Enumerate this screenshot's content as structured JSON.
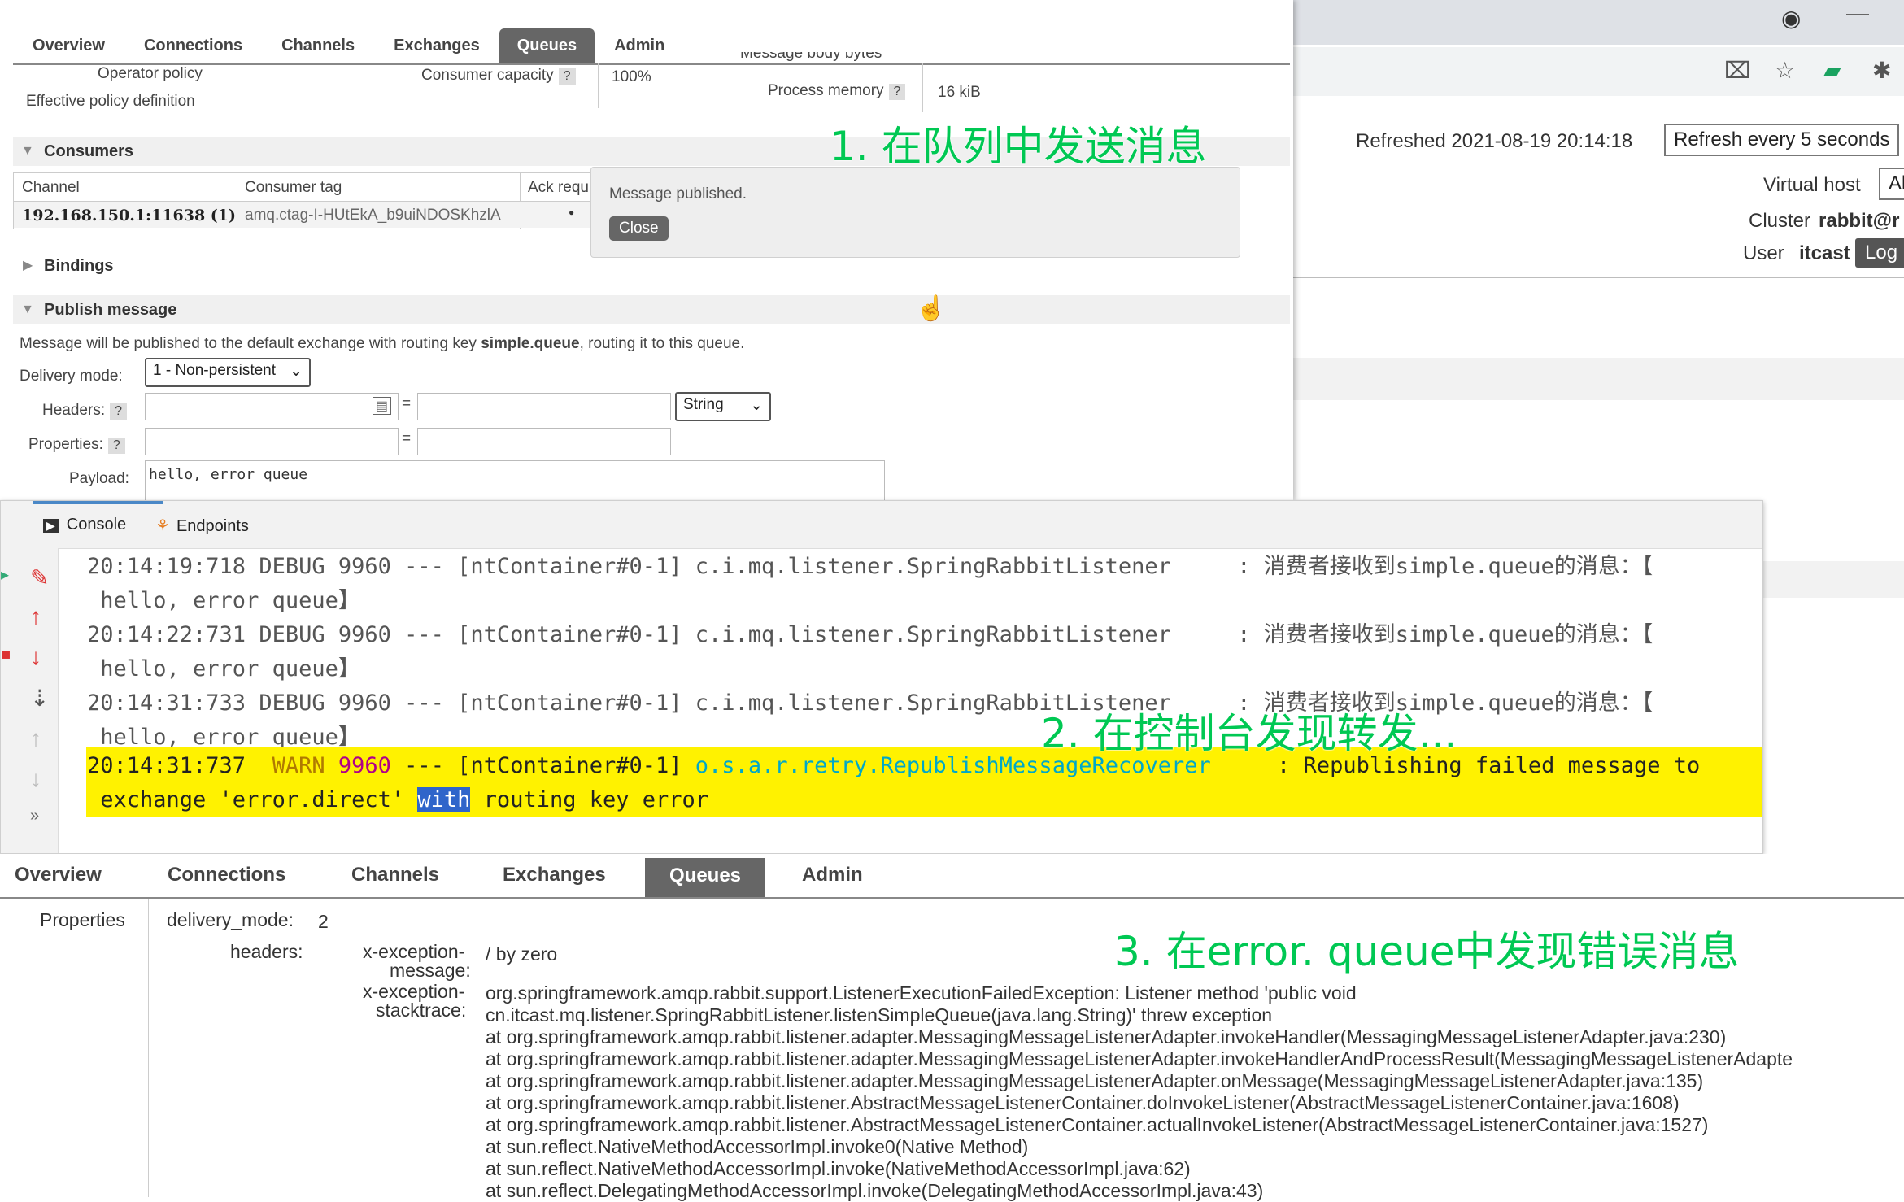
{
  "top_panel": {
    "nav": [
      "Overview",
      "Connections",
      "Channels",
      "Exchanges",
      "Queues",
      "Admin"
    ],
    "active_tab": "Queues",
    "operator_policy_label": "Operator policy",
    "effective_policy_label": "Effective policy definition",
    "consumer_capacity_label": "Consumer capacity",
    "consumer_capacity_value": "100%",
    "message_body_bytes_label": "Message body bytes",
    "process_memory_label": "Process memory",
    "process_memory_value": "16 kiB",
    "consumers_heading": "Consumers",
    "consumers_table": {
      "headers": [
        "Channel",
        "Consumer tag",
        "Ack requ"
      ],
      "row": {
        "channel": "192.168.150.1:11638 (1)",
        "tag": "amq.ctag-I-HUtEkA_b9uiNDOSKhzlA",
        "ack": "●"
      }
    },
    "bindings_heading": "Bindings",
    "publish_heading": "Publish message",
    "publish_info_pre": "Message will be published to the default exchange with routing key ",
    "publish_info_key": "simple.queue",
    "publish_info_post": ", routing it to this queue.",
    "delivery_mode_label": "Delivery mode:",
    "delivery_mode_value": "1 - Non-persistent",
    "headers_label": "Headers:",
    "header_type_value": "String",
    "properties_label": "Properties:",
    "payload_label": "Payload:",
    "payload_value": "hello, error queue",
    "help_symbol": "?",
    "equals": "="
  },
  "notice": {
    "message": "Message published.",
    "close_label": "Close"
  },
  "annotations": {
    "a1": "1. 在队列中发送消息",
    "a2": "2. 在控制台发现转发...",
    "a3": "3. 在error. queue中发现错误消息"
  },
  "browser": {
    "refreshed": "Refreshed 2021-08-19 20:14:18",
    "refresh_select": "Refresh every 5 seconds",
    "virtual_host_label": "Virtual host",
    "virtual_host_value": "Al",
    "cluster_label": "Cluster",
    "cluster_value": "rabbit@r",
    "user_label": "User",
    "user_value": "itcast",
    "logout_label": "Log"
  },
  "console": {
    "tabs": [
      "Console",
      "Endpoints"
    ],
    "lines": [
      "20:14:19:718 DEBUG 9960 --- [ntContainer#0-1] c.i.mq.listener.SpringRabbitListener     : 消费者接收到simple.queue的消息：【",
      " hello, error queue】",
      "20:14:22:731 DEBUG 9960 --- [ntContainer#0-1] c.i.mq.listener.SpringRabbitListener     : 消费者接收到simple.queue的消息：【",
      " hello, error queue】",
      "20:14:31:733 DEBUG 9960 --- [ntContainer#0-1] c.i.mq.listener.SpringRabbitListener     : 消费者接收到simple.queue的消息：【",
      " hello, error queue】"
    ],
    "warn": {
      "time": "20:14:31:737",
      "level": "WARN",
      "pid": "9960",
      "sep": " --- [ntContainer#0-1] ",
      "logger": "o.s.a.r.retry.RepublishMessageRecoverer",
      "msg": "     : Republishing failed message to",
      "line2_pre": " exchange 'error.direct' ",
      "line2_sel": "with",
      "line2_post": " routing key error"
    }
  },
  "bottom_panel": {
    "nav": [
      "Overview",
      "Connections",
      "Channels",
      "Exchanges",
      "Queues",
      "Admin"
    ],
    "active_tab": "Queues",
    "properties_label": "Properties",
    "delivery_mode_label": "delivery_mode:",
    "delivery_mode_value": "2",
    "headers_label": "headers:",
    "exc_msg_label_1": "x-exception-",
    "exc_msg_label_2": "message:",
    "exc_msg_value": "/ by zero",
    "exc_stack_label_1": "x-exception-",
    "exc_stack_label_2": "stacktrace:",
    "stacktrace": [
      "org.springframework.amqp.rabbit.support.ListenerExecutionFailedException: Listener method 'public void",
      "cn.itcast.mq.listener.SpringRabbitListener.listenSimpleQueue(java.lang.String)' threw exception",
      "at org.springframework.amqp.rabbit.listener.adapter.MessagingMessageListenerAdapter.invokeHandler(MessagingMessageListenerAdapter.java:230)",
      "at org.springframework.amqp.rabbit.listener.adapter.MessagingMessageListenerAdapter.invokeHandlerAndProcessResult(MessagingMessageListenerAdapte",
      "at org.springframework.amqp.rabbit.listener.adapter.MessagingMessageListenerAdapter.onMessage(MessagingMessageListenerAdapter.java:135)",
      "at org.springframework.amqp.rabbit.listener.AbstractMessageListenerContainer.doInvokeListener(AbstractMessageListenerContainer.java:1608)",
      "at org.springframework.amqp.rabbit.listener.AbstractMessageListenerContainer.actualInvokeListener(AbstractMessageListenerContainer.java:1527)",
      "at sun.reflect.NativeMethodAccessorImpl.invoke0(Native Method)",
      "at sun.reflect.NativeMethodAccessorImpl.invoke(NativeMethodAccessorImpl.java:62)",
      "at sun.reflect.DelegatingMethodAccessorImpl.invoke(DelegatingMethodAccessorImpl.java:43)"
    ]
  },
  "icons": {
    "browser_profile": "profile-icon",
    "translate": "translate-icon",
    "star": "star-icon",
    "extension": "extension-icon",
    "cursor": "hand-cursor-icon"
  },
  "colors": {
    "annotation": "#00c853",
    "warn_highlight": "#fff200",
    "tab_active": "#666666",
    "logger_cyan": "#00a8c8"
  }
}
